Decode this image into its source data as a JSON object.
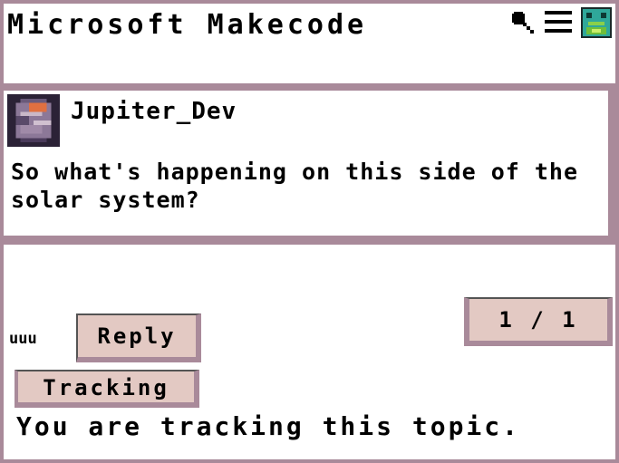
{
  "header": {
    "app_title": "Microsoft Makecode",
    "icons": [
      "search-icon",
      "menu-icon",
      "user-avatar-icon"
    ]
  },
  "post": {
    "author": "Jupiter_Dev",
    "body": "So what's happening on this side of the solar system?"
  },
  "footer": {
    "user_tag": "uuu",
    "reply_label": "Reply",
    "page_indicator": "1 / 1",
    "tracking_label": "Tracking",
    "tracking_status": "You are tracking this topic."
  },
  "colors": {
    "border": "#a98a9a",
    "button_bg": "#e3c9c3",
    "background": "#ffffff",
    "avatar_accent": "#2fa89a"
  }
}
